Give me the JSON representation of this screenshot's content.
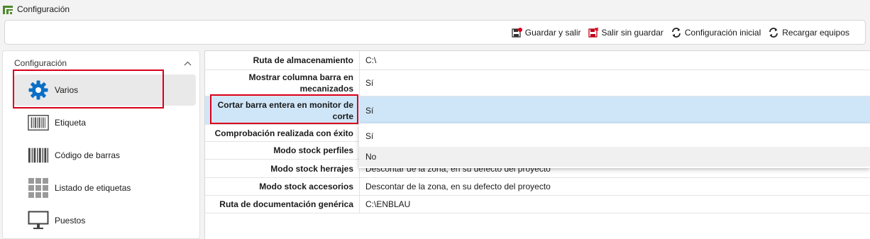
{
  "window": {
    "title": "Configuración"
  },
  "toolbar": {
    "save_exit": "Guardar y salir",
    "exit_no_save": "Salir sin guardar",
    "initial_config": "Configuración inicial",
    "reload_equipment": "Recargar equipos"
  },
  "sidebar": {
    "header": "Configuración",
    "items": [
      {
        "label": "Varios",
        "icon": "gear-icon"
      },
      {
        "label": "Etiqueta",
        "icon": "label-icon"
      },
      {
        "label": "Código de barras",
        "icon": "barcode-icon"
      },
      {
        "label": "Listado de etiquetas",
        "icon": "grid-list-icon"
      },
      {
        "label": "Puestos",
        "icon": "monitor-icon"
      }
    ]
  },
  "properties": [
    {
      "label": "Ruta de almacenamiento",
      "value": "C:\\"
    },
    {
      "label": "Mostrar columna barra en mecanizados",
      "value": "Sí"
    },
    {
      "label": "Cortar barra entera en monitor de corte",
      "value": "Sí"
    },
    {
      "label": "Comprobación realizada con éxito",
      "value": ""
    },
    {
      "label": "Modo stock perfiles",
      "value": ""
    },
    {
      "label": "Modo stock herrajes",
      "value": "Descontar de la zona, en su defecto del proyecto"
    },
    {
      "label": "Modo stock accesorios",
      "value": "Descontar de la zona, en su defecto del proyecto"
    },
    {
      "label": "Ruta de documentación genérica",
      "value": "C:\\ENBLAU"
    }
  ],
  "dropdown": {
    "options": [
      "Sí",
      "No"
    ]
  },
  "colors": {
    "accent": "#0b6fc6",
    "highlight_row": "#cfe6f8",
    "annotation": "#d9001b"
  }
}
